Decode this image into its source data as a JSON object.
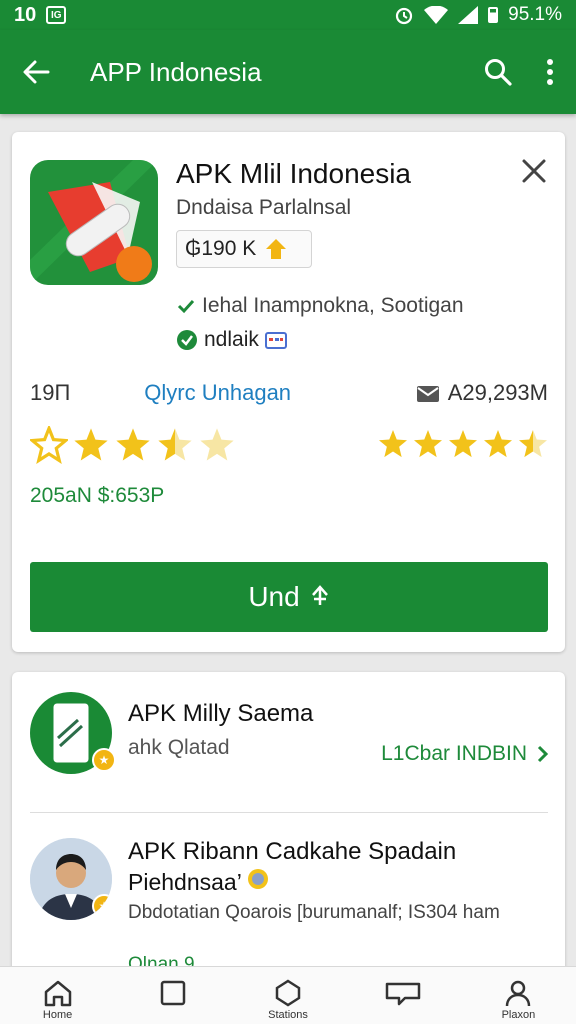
{
  "status": {
    "left_text": "10",
    "right_text": "95.1%"
  },
  "appbar": {
    "title": "APP Indonesia"
  },
  "app": {
    "title": "APK Mlil Indonesia",
    "subtitle": "Dndaisa Parlalnsal",
    "price": "₲190 K",
    "feature1": "Iehal Inampnokna, Sootigan",
    "feature2": "ndlaik",
    "downloads": "19П",
    "link": "Qlyrc Unhagan",
    "size": "A29,293M",
    "rating_left": 3.5,
    "rating_right": 4.5,
    "reviews": "205aN $:653P",
    "install_label": "Und"
  },
  "related": [
    {
      "title": "APK Milly Saema",
      "subtitle": "ahk Qlatad",
      "link": "L1Cbar INDBIN"
    },
    {
      "title": "APK Ribann Cadkahe Spadain",
      "subtitle": "Piehdnsaa’",
      "description": "Dbdotatian Qoarois [burumanalf; IS304 ham",
      "extra": "Olnan 9"
    }
  ],
  "nav": [
    {
      "label": "Home",
      "icon": "home-icon"
    },
    {
      "label": "",
      "icon": "square-icon"
    },
    {
      "label": "Stations",
      "icon": "circle-icon"
    },
    {
      "label": "",
      "icon": "chat-icon"
    },
    {
      "label": "Plaxon",
      "icon": "person-icon"
    }
  ],
  "colors": {
    "brand": "#1a8a35",
    "link": "#1f7fc0",
    "star": "#f2c21a"
  }
}
